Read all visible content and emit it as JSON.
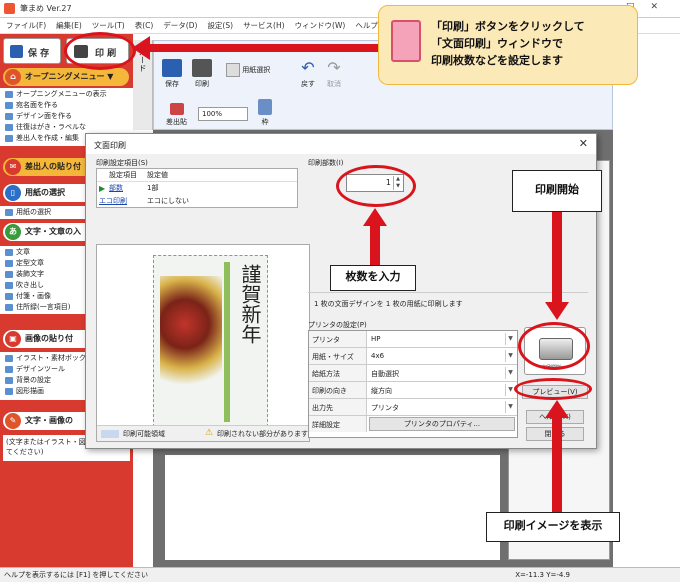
{
  "app": {
    "title": "筆まめ Ver.27"
  },
  "window_controls": {
    "minimize": "—",
    "maximize": "□",
    "close": "✕"
  },
  "menubar": [
    "ファイル(F)",
    "編集(E)",
    "ツール(T)",
    "表(C)",
    "データ(D)",
    "設定(S)",
    "サービス(H)",
    "ウィンドウ(W)",
    "ヘルプ(H)"
  ],
  "sidebar": {
    "save_label": "保 存",
    "print_label": "印 刷",
    "sections": [
      {
        "label": "オープニングメニュー ▼",
        "items": [
          "オープニングメニューの表示",
          "宛名面を作る",
          "デザイン面を作る",
          "往復はがき・ラベルな",
          "差出人を作成・編集"
        ]
      },
      {
        "label": "差出人の貼り付",
        "items": []
      },
      {
        "label": "用紙の選択",
        "items": [
          "用紙の選択"
        ]
      },
      {
        "label": "文字・文章の入",
        "items": [
          "文章",
          "定型文章",
          "装飾文字",
          "吹き出し",
          "付箋・画像",
          "住所録(一言項目)"
        ]
      },
      {
        "label": "画像の貼り付",
        "items": [
          "イラスト・素材ボックス",
          "デザインツール",
          "背景の設定",
          "図形描画"
        ]
      },
      {
        "label": "文字・画像の",
        "items": []
      }
    ],
    "section_icon_glyph": "あ",
    "help_text": "(文字またはイラスト・図形を選択してください)"
  },
  "side_tab": "カード",
  "app_toolbar": {
    "save": "保存",
    "print": "印刷",
    "paper_select": "用紙選択",
    "undo": "戻す",
    "redo": "取消",
    "sender": "差出貼",
    "zoom": "100%",
    "frame": "枠"
  },
  "dialog": {
    "title": "文面印刷",
    "close": "✕",
    "settings_label": "印刷設定項目(S)",
    "table_headers": [
      "設定項目",
      "設定値"
    ],
    "table_rows": [
      [
        "部数",
        "1部"
      ],
      [
        "エコ印刷",
        "エコにしない"
      ]
    ],
    "copies_label": "印刷部数(I)",
    "copies_value": "1",
    "info_text": "1 枚の文面デザインを 1 枚の用紙に印刷します",
    "printer_settings_label": "プリンタの設定(P)",
    "printer_rows": [
      {
        "key": "プリンタ",
        "value": "HP"
      },
      {
        "key": "用紙・サイズ",
        "value": "4x6"
      },
      {
        "key": "給紙方法",
        "value": "自動選択"
      },
      {
        "key": "印刷の向き",
        "value": "縦方向"
      },
      {
        "key": "出力先",
        "value": "プリンタ"
      },
      {
        "key": "詳細設定",
        "value": "プリンタのプロパティ..."
      }
    ],
    "print_button_caption": "印刷開始",
    "preview_button": "プレビュー(V)",
    "help_button": "ヘルプ(H)",
    "close_button": "閉じる",
    "printable_area_label": "印刷可能領域",
    "warning_text": "印刷されない部分があります",
    "card_text": "謹賀新年"
  },
  "annotations": {
    "bubble_lines": [
      "「印刷」ボタンをクリックして",
      "「文面印刷」ウィンドウで",
      "印刷枚数などを設定します"
    ],
    "print_start": "印刷開始",
    "copies_input": "枚数を入力",
    "show_preview": "印刷イメージを表示"
  },
  "statusbar": {
    "help": "ヘルプを表示するには [F1] を押してください",
    "coords": "X=-11.3 Y=-4.9"
  },
  "colors": {
    "sidebar_red": "#d83a2f",
    "section_orange": "#f4b73a",
    "callout_red": "#d9141c",
    "bubble_fill": "#fce9b8"
  }
}
